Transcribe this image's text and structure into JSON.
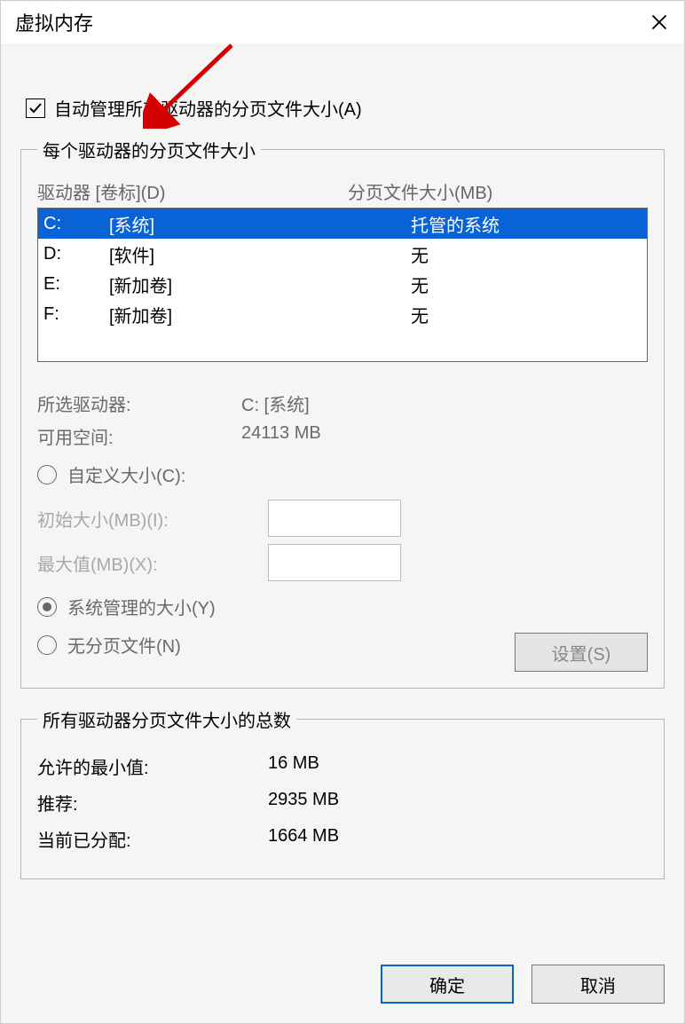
{
  "window": {
    "title": "虚拟内存"
  },
  "auto_manage": {
    "label": "自动管理所有驱动器的分页文件大小(A)",
    "checked": true
  },
  "drives_group": {
    "legend": "每个驱动器的分页文件大小",
    "header_drive": "驱动器 [卷标](D)",
    "header_size": "分页文件大小(MB)",
    "rows": [
      {
        "letter": "C:",
        "volume": "[系统]",
        "size": "托管的系统",
        "selected": true
      },
      {
        "letter": "D:",
        "volume": "[软件]",
        "size": "无",
        "selected": false
      },
      {
        "letter": "E:",
        "volume": "[新加卷]",
        "size": "无",
        "selected": false
      },
      {
        "letter": "F:",
        "volume": "[新加卷]",
        "size": "无",
        "selected": false
      }
    ],
    "selected_label": "所选驱动器:",
    "selected_value": "C:  [系统]",
    "free_label": "可用空间:",
    "free_value": "24113 MB",
    "custom_label": "自定义大小(C):",
    "initial_label": "初始大小(MB)(I):",
    "max_label": "最大值(MB)(X):",
    "system_managed_label": "系统管理的大小(Y)",
    "no_paging_label": "无分页文件(N)",
    "set_button": "设置(S)"
  },
  "totals_group": {
    "legend": "所有驱动器分页文件大小的总数",
    "min_label": "允许的最小值:",
    "min_value": "16 MB",
    "rec_label": "推荐:",
    "rec_value": "2935 MB",
    "cur_label": "当前已分配:",
    "cur_value": "1664 MB"
  },
  "buttons": {
    "ok": "确定",
    "cancel": "取消"
  }
}
